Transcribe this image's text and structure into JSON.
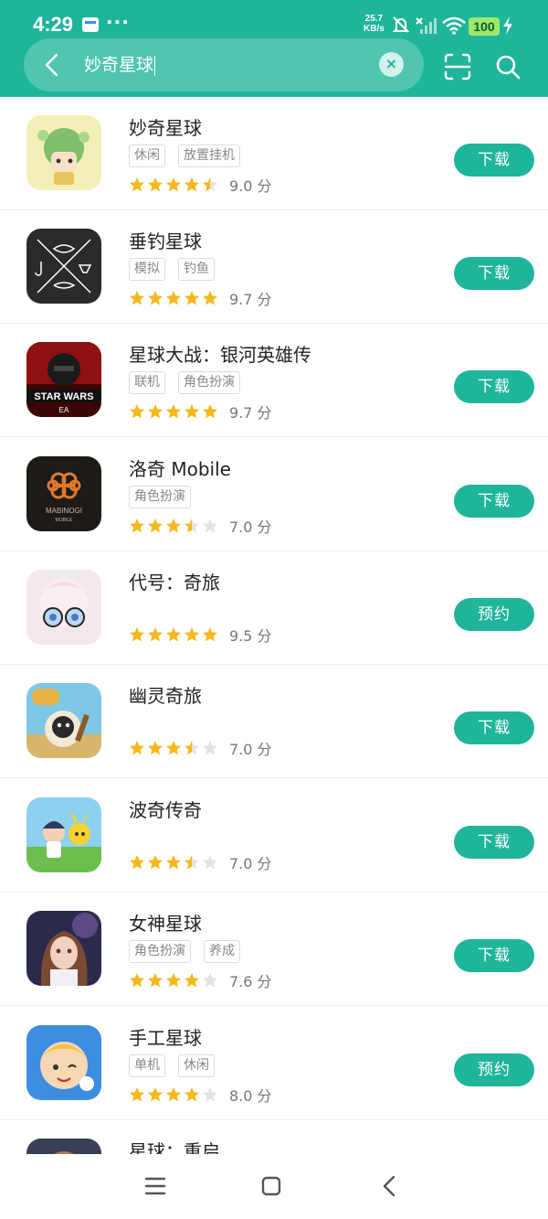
{
  "status_bar": {
    "time": "4:29",
    "dots": "···",
    "net_speed_value": "25.7",
    "net_speed_unit": "KB/s",
    "battery": "100"
  },
  "search": {
    "query": "妙奇星球",
    "clear_label": "×"
  },
  "colors": {
    "accent": "#1fb59a",
    "star_filled": "#f5b81c",
    "star_empty": "#e3e3e3"
  },
  "apps": [
    {
      "name": "妙奇星球",
      "tags": [
        "休闲",
        "放置挂机"
      ],
      "stars": 4.5,
      "score": "9.0 分",
      "button": "下载"
    },
    {
      "name": "垂钓星球",
      "tags": [
        "模拟",
        "钓鱼"
      ],
      "stars": 5,
      "score": "9.7 分",
      "button": "下载"
    },
    {
      "name": "星球大战：银河英雄传",
      "tags": [
        "联机",
        "角色扮演"
      ],
      "stars": 5,
      "score": "9.7 分",
      "button": "下载"
    },
    {
      "name": "洛奇 Mobile",
      "tags": [
        "角色扮演"
      ],
      "stars": 3.5,
      "score": "7.0 分",
      "button": "下载"
    },
    {
      "name": "代号：奇旅",
      "tags": [],
      "stars": 5,
      "score": "9.5 分",
      "button": "预约"
    },
    {
      "name": "幽灵奇旅",
      "tags": [],
      "stars": 3.5,
      "score": "7.0 分",
      "button": "下载"
    },
    {
      "name": "波奇传奇",
      "tags": [],
      "stars": 3.5,
      "score": "7.0 分",
      "button": "下载"
    },
    {
      "name": "女神星球",
      "tags": [
        "角色扮演",
        "养成"
      ],
      "stars": 4,
      "score": "7.6 分",
      "button": "下载"
    },
    {
      "name": "手工星球",
      "tags": [
        "单机",
        "休闲"
      ],
      "stars": 4,
      "score": "8.0 分",
      "button": "预约"
    },
    {
      "name": "星球：重启",
      "tags": [],
      "stars": 0,
      "score": "",
      "button": ""
    }
  ],
  "nav_icons": [
    "menu-icon",
    "home-icon",
    "back-icon"
  ]
}
